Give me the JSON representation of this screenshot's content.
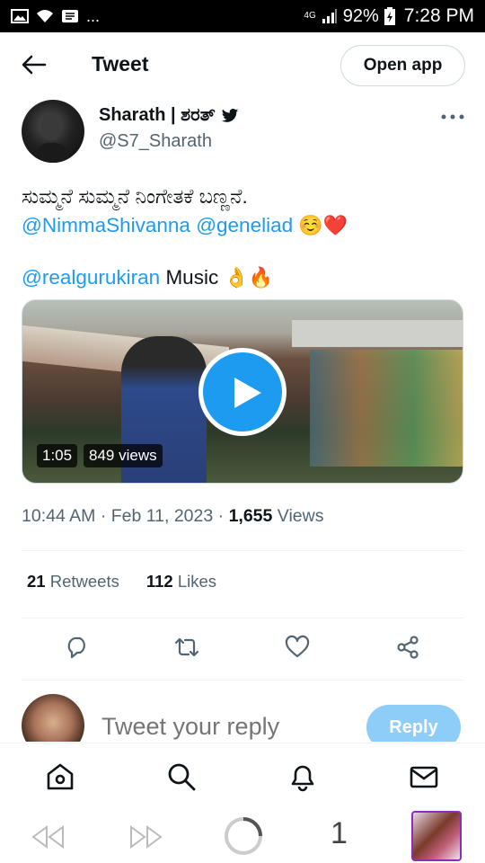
{
  "status_bar": {
    "network": "4G",
    "battery": "92%",
    "time": "7:28 PM",
    "dots": "..."
  },
  "header": {
    "title": "Tweet",
    "open_app_label": "Open app"
  },
  "author": {
    "name": "Sharath | ಶರತ್",
    "handle": "@S7_Sharath"
  },
  "tweet": {
    "line1": "ಸುಮ್ಮನೆ ಸುಮ್ಮನೆ ನಿಂಗೇತಕೆ ಬಣ್ಣನೆ.",
    "mention1": "@NimmaShivanna",
    "mention2": "@geneliad",
    "emoji_line2": "☺️❤️",
    "mention3": "@realgurukiran",
    "word_music": "Music",
    "emoji_line3": "👌🔥"
  },
  "media": {
    "duration": "1:05",
    "views": "849 views"
  },
  "meta": {
    "time": "10:44 AM",
    "sep1": "·",
    "date": "Feb 11, 2023",
    "sep2": "·",
    "views_count": "1,655",
    "views_label": "Views"
  },
  "stats": {
    "retweets_count": "21",
    "retweets_label": "Retweets",
    "likes_count": "112",
    "likes_label": "Likes"
  },
  "reply": {
    "placeholder": "Tweet your reply",
    "button_label": "Reply"
  },
  "sys_nav": {
    "tab_count": "1"
  },
  "colors": {
    "accent": "#1d9bf0",
    "reply_button_disabled": "#8ecdf8",
    "secondary_text": "#536471"
  }
}
